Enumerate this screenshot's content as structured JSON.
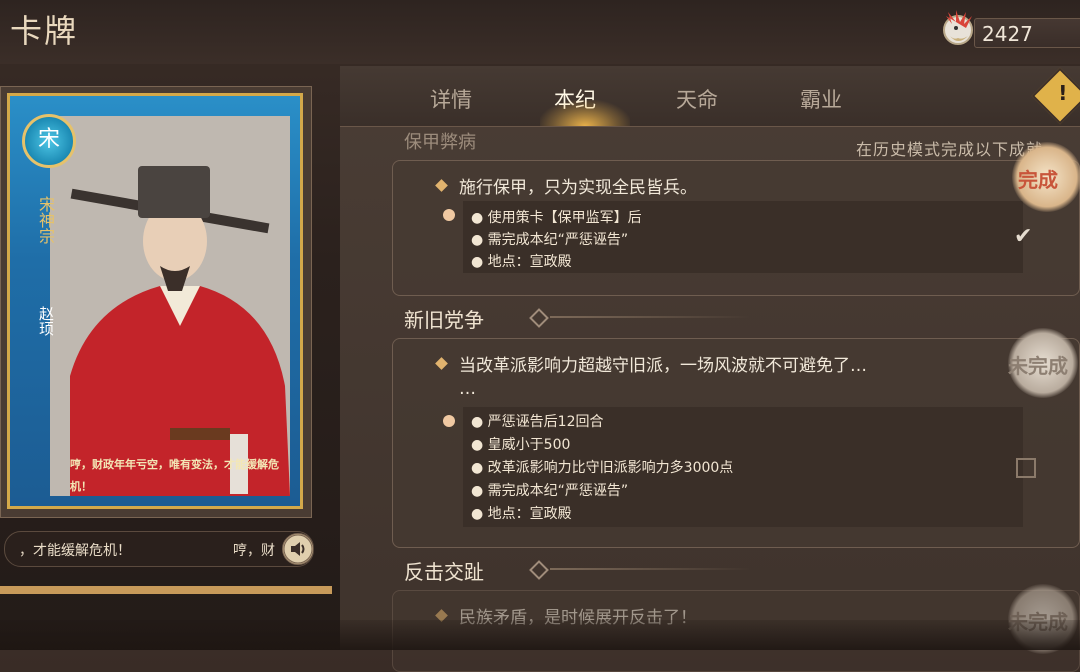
{
  "header": {
    "title": "卡牌",
    "currency_value": "2427"
  },
  "card": {
    "faction_glyph": "宋",
    "faction_name": "宋神宗",
    "character_name": "赵顼",
    "quote": "哼，财政年年亏空，唯有变法，才能缓解危机！"
  },
  "quote_bar": {
    "text_left": "，才能缓解危机！",
    "text_right": "哼，财"
  },
  "tabs": [
    {
      "label": "详情",
      "active": false
    },
    {
      "label": "本纪",
      "active": true
    },
    {
      "label": "天命",
      "active": false
    },
    {
      "label": "霸业",
      "active": false
    }
  ],
  "alert_label": "!",
  "chapters": {
    "prev_head": "保甲弊病",
    "hint": "在历史模式完成以下成就",
    "quest1": {
      "title": "施行保甲，只为实现全民皆兵。",
      "conditions": [
        "使用策卡【保甲监军】后",
        "需完成本纪“严惩诬告”",
        "地点：宣政殿"
      ],
      "checked": true,
      "stamp": "完成"
    },
    "section2_title": "新旧党争",
    "quest2": {
      "title": "当改革派影响力超越守旧派，一场风波就不可避免了…",
      "title_cont": "…",
      "conditions": [
        "严惩诬告后12回合",
        "皇威小于500",
        "改革派影响力比守旧派影响力多3000点",
        "需完成本纪“严惩诬告”",
        "地点：宣政殿"
      ],
      "checked": false,
      "stamp": "未完成"
    },
    "section3_title": "反击交趾",
    "quest3": {
      "title": "民族矛盾，是时候展开反击了！",
      "stamp": "未完成"
    }
  },
  "colors": {
    "accent": "#e1b36e",
    "stamp_done": "#c8553a",
    "stamp_pending": "#a89a8c"
  }
}
